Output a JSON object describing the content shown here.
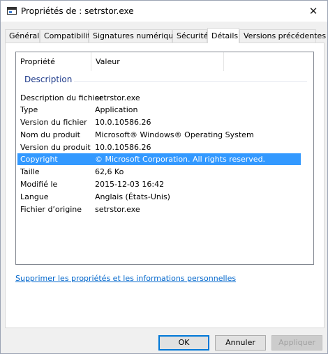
{
  "window": {
    "title": "Propriétés de : setrstor.exe",
    "close_glyph": "✕",
    "icon": "window-icon"
  },
  "tabs": [
    {
      "label": "Général"
    },
    {
      "label": "Compatibilité"
    },
    {
      "label": "Signatures numériques"
    },
    {
      "label": "Sécurité"
    },
    {
      "label": "Détails",
      "active": true
    },
    {
      "label": "Versions précédentes"
    }
  ],
  "details": {
    "columns": [
      "Propriété",
      "Valeur",
      ""
    ],
    "group": "Description",
    "rows": [
      {
        "key": "Description du fichier",
        "value": "setrstor.exe"
      },
      {
        "key": "Type",
        "value": "Application"
      },
      {
        "key": "Version du fichier",
        "value": "10.0.10586.26"
      },
      {
        "key": "Nom du produit",
        "value": "Microsoft® Windows® Operating System"
      },
      {
        "key": "Version du produit",
        "value": "10.0.10586.26"
      },
      {
        "key": "Copyright",
        "value": "© Microsoft Corporation. All rights reserved.",
        "selected": true
      },
      {
        "key": "Taille",
        "value": "62,6 Ko"
      },
      {
        "key": "Modifié le",
        "value": "2015-12-03 16:42"
      },
      {
        "key": "Langue",
        "value": "Anglais (États-Unis)"
      },
      {
        "key": "Fichier d’origine",
        "value": "setrstor.exe"
      }
    ]
  },
  "remove_link": "Supprimer les propriétés et les informations personnelles",
  "buttons": {
    "ok": "OK",
    "cancel": "Annuler",
    "apply": "Appliquer"
  },
  "colors": {
    "selection": "#3399ff",
    "link": "#0066cc",
    "group_header": "#1e3a8a"
  }
}
